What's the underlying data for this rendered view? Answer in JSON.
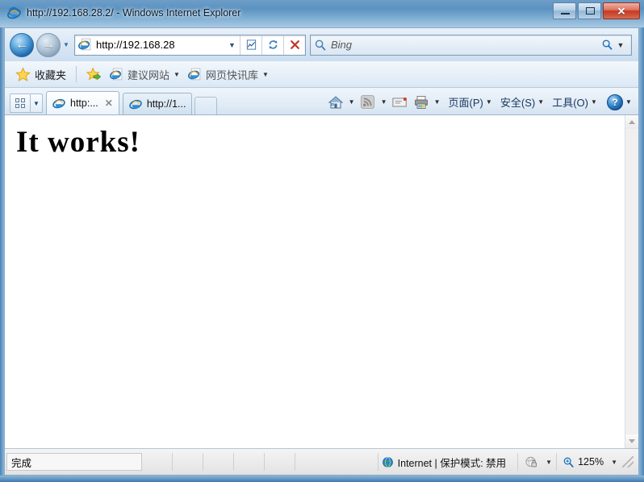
{
  "window": {
    "title": "http://192.168.28.2/ - Windows Internet Explorer",
    "ie_icon": "ie-logo-icon",
    "controls": {
      "minimize": "minimize-button",
      "maximize": "maximize-button",
      "close_label": "✕"
    }
  },
  "navbar": {
    "back_glyph": "←",
    "forward_glyph": "→",
    "recent_caret": "▼",
    "address": {
      "value": "http://192.168.28",
      "dropdown_caret": "▼",
      "compatibility_icon": "compatibility-view-icon",
      "refresh_icon": "refresh-icon",
      "stop_glyph": "✕"
    },
    "search": {
      "placeholder": "Bing",
      "icon": "search-magnifier-icon",
      "caret": "▼"
    }
  },
  "favorites_bar": {
    "favorites_label": "收藏夹",
    "add_icon": "add-to-favorites-icon",
    "items": [
      {
        "label": "建议网站",
        "icon": "ie-page-icon",
        "caret": "▼"
      },
      {
        "label": "网页快讯库",
        "icon": "ie-page-icon",
        "caret": "▼"
      }
    ]
  },
  "tabs": {
    "quick_tabs_icon": "quick-tabs-grid-icon",
    "tab_list_caret": "▼",
    "items": [
      {
        "title": "http:...",
        "active": true,
        "close_glyph": "✕"
      },
      {
        "title": "http://1...",
        "active": false
      }
    ],
    "new_tab": "new-tab-button"
  },
  "command_bar": {
    "home_icon": "home-icon",
    "feeds_icon": "rss-feed-icon",
    "read_mail_icon": "read-mail-icon",
    "print_icon": "print-icon",
    "caret": "▼",
    "menus": [
      {
        "label": "页面(P)",
        "caret": "▼"
      },
      {
        "label": "安全(S)",
        "caret": "▼"
      },
      {
        "label": "工具(O)",
        "caret": "▼"
      }
    ],
    "help": {
      "glyph": "?",
      "caret": "▼"
    }
  },
  "page": {
    "heading": "It works!"
  },
  "scrollbar": {
    "up_arrow": "scroll-up-arrow",
    "down_arrow": "scroll-down-arrow"
  },
  "statusbar": {
    "status": "完成",
    "zone_icon": "internet-globe-icon",
    "zone": "Internet | 保护模式: 禁用",
    "privacy_icon": "privacy-report-icon",
    "privacy_caret": "▼",
    "zoom_icon": "zoom-magnifier-icon",
    "zoom_level": "125%",
    "zoom_caret": "▼"
  },
  "colors": {
    "accent": "#1e6bb0",
    "close_red": "#c43a20",
    "chrome_bg": "#dae8f4",
    "menu_text": "#16365e"
  }
}
